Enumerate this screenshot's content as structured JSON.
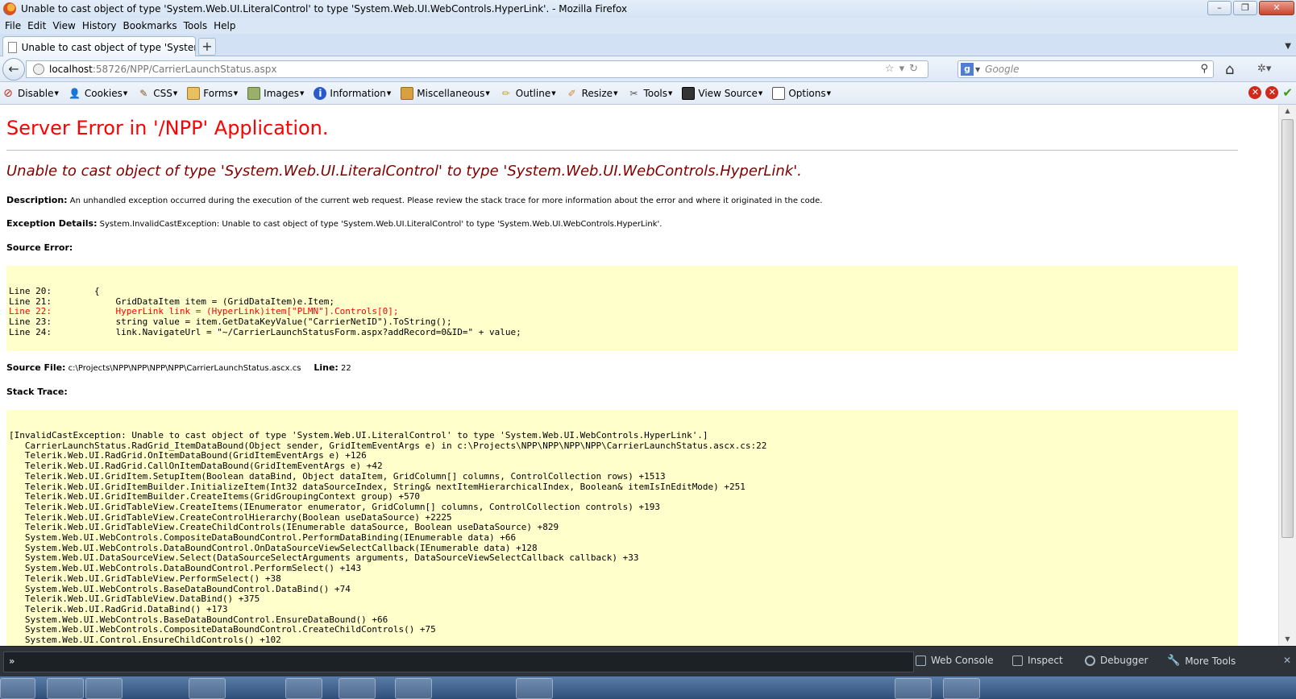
{
  "window": {
    "title": "Unable to cast object of type 'System.Web.UI.LiteralControl' to type 'System.Web.UI.WebControls.HyperLink'. - Mozilla Firefox",
    "controls": [
      "–",
      "❐",
      "✕"
    ]
  },
  "menubar": {
    "items": [
      "File",
      "Edit",
      "View",
      "History",
      "Bookmarks",
      "Tools",
      "Help"
    ]
  },
  "tabs": {
    "active_label": "Unable to cast object of type 'System.W...",
    "new_tab_symbol": "+"
  },
  "navbar": {
    "back_symbol": "←",
    "url_host": "localhost",
    "url_path": ":58726/NPP/CarrierLaunchStatus.aspx",
    "search_placeholder": "Google",
    "search_engine_icon": "google-icon"
  },
  "devtoolbar": {
    "items": [
      {
        "label": "Disable",
        "icon": "disable-icon",
        "color": "#d02a1a"
      },
      {
        "label": "Cookies",
        "icon": "cookies-icon",
        "color": "#333333"
      },
      {
        "label": "CSS",
        "icon": "css-icon",
        "color": "#7a5a1a"
      },
      {
        "label": "Forms",
        "icon": "forms-icon",
        "color": "#c89a2a"
      },
      {
        "label": "Images",
        "icon": "images-icon",
        "color": "#5a7a3a"
      },
      {
        "label": "Information",
        "icon": "information-icon",
        "color": "#2a5ac8"
      },
      {
        "label": "Miscellaneous",
        "icon": "miscellaneous-icon",
        "color": "#c88a2a"
      },
      {
        "label": "Outline",
        "icon": "outline-icon",
        "color": "#c8a02a"
      },
      {
        "label": "Resize",
        "icon": "resize-icon",
        "color": "#d08a3a"
      },
      {
        "label": "Tools",
        "icon": "tools-icon",
        "color": "#555555"
      },
      {
        "label": "View Source",
        "icon": "view-source-icon",
        "color": "#333333"
      },
      {
        "label": "Options",
        "icon": "options-icon",
        "color": "#555555"
      }
    ]
  },
  "page": {
    "heading": "Server Error in '/NPP' Application.",
    "subheading": "Unable to cast object of type 'System.Web.UI.LiteralControl' to type 'System.Web.UI.WebControls.HyperLink'.",
    "description_label": "Description:",
    "description_text": " An unhandled exception occurred during the execution of the current web request. Please review the stack trace for more information about the error and where it originated in the code.",
    "exception_label": "Exception Details:",
    "exception_text": " System.InvalidCastException: Unable to cast object of type 'System.Web.UI.LiteralControl' to type 'System.Web.UI.WebControls.HyperLink'.",
    "source_error_label": "Source Error:",
    "source_lines": [
      {
        "text": "Line 20:        {",
        "error": false
      },
      {
        "text": "Line 21:            GridDataItem item = (GridDataItem)e.Item;",
        "error": false
      },
      {
        "text": "Line 22:            HyperLink link = (HyperLink)item[\"PLMN\"].Controls[0];",
        "error": true
      },
      {
        "text": "Line 23:            string value = item.GetDataKeyValue(\"CarrierNetID\").ToString();",
        "error": false
      },
      {
        "text": "Line 24:            link.NavigateUrl = \"~/CarrierLaunchStatusForm.aspx?addRecord=0&ID=\" + value;",
        "error": false
      }
    ],
    "source_file_label": "Source File:",
    "source_file_value": " c:\\Projects\\NPP\\NPP\\NPP\\NPP\\CarrierLaunchStatus.ascx.cs",
    "line_label": "Line:",
    "line_value": " 22",
    "stack_trace_label": "Stack Trace:",
    "stack_lines": [
      "[InvalidCastException: Unable to cast object of type 'System.Web.UI.LiteralControl' to type 'System.Web.UI.WebControls.HyperLink'.]",
      "   CarrierLaunchStatus.RadGrid_ItemDataBound(Object sender, GridItemEventArgs e) in c:\\Projects\\NPP\\NPP\\NPP\\NPP\\CarrierLaunchStatus.ascx.cs:22",
      "   Telerik.Web.UI.RadGrid.OnItemDataBound(GridItemEventArgs e) +126",
      "   Telerik.Web.UI.RadGrid.CallOnItemDataBound(GridItemEventArgs e) +42",
      "   Telerik.Web.UI.GridItem.SetupItem(Boolean dataBind, Object dataItem, GridColumn[] columns, ControlCollection rows) +1513",
      "   Telerik.Web.UI.GridItemBuilder.InitializeItem(Int32 dataSourceIndex, String& nextItemHierarchicalIndex, Boolean& itemIsInEditMode) +251",
      "   Telerik.Web.UI.GridItemBuilder.CreateItems(GridGroupingContext group) +570",
      "   Telerik.Web.UI.GridTableView.CreateItems(IEnumerator enumerator, GridColumn[] columns, ControlCollection controls) +193",
      "   Telerik.Web.UI.GridTableView.CreateControlHierarchy(Boolean useDataSource) +2225",
      "   Telerik.Web.UI.GridTableView.CreateChildControls(IEnumerable dataSource, Boolean useDataSource) +829",
      "   System.Web.UI.WebControls.CompositeDataBoundControl.PerformDataBinding(IEnumerable data) +66",
      "   System.Web.UI.WebControls.DataBoundControl.OnDataSourceViewSelectCallback(IEnumerable data) +128",
      "   System.Web.UI.DataSourceView.Select(DataSourceSelectArguments arguments, DataSourceViewSelectCallback callback) +33",
      "   System.Web.UI.WebControls.DataBoundControl.PerformSelect() +143",
      "   Telerik.Web.UI.GridTableView.PerformSelect() +38",
      "   System.Web.UI.WebControls.BaseDataBoundControl.DataBind() +74",
      "   Telerik.Web.UI.GridTableView.DataBind() +375",
      "   Telerik.Web.UI.RadGrid.DataBind() +173",
      "   System.Web.UI.WebControls.BaseDataBoundControl.EnsureDataBound() +66",
      "   System.Web.UI.WebControls.CompositeDataBoundControl.CreateChildControls() +75",
      "   System.Web.UI.Control.EnsureChildControls() +102"
    ]
  },
  "devtools": {
    "prompt": "»",
    "buttons": [
      {
        "label": "Web Console",
        "icon": "web-console-icon"
      },
      {
        "label": "Inspect",
        "icon": "inspect-icon"
      },
      {
        "label": "Debugger",
        "icon": "debugger-icon"
      },
      {
        "label": "More Tools",
        "icon": "more-tools-icon"
      }
    ]
  },
  "colors": {
    "heading_red": "#ff0000",
    "subheading_maroon": "#800000",
    "code_background": "#ffffcc",
    "error_line": "#ff0000"
  }
}
